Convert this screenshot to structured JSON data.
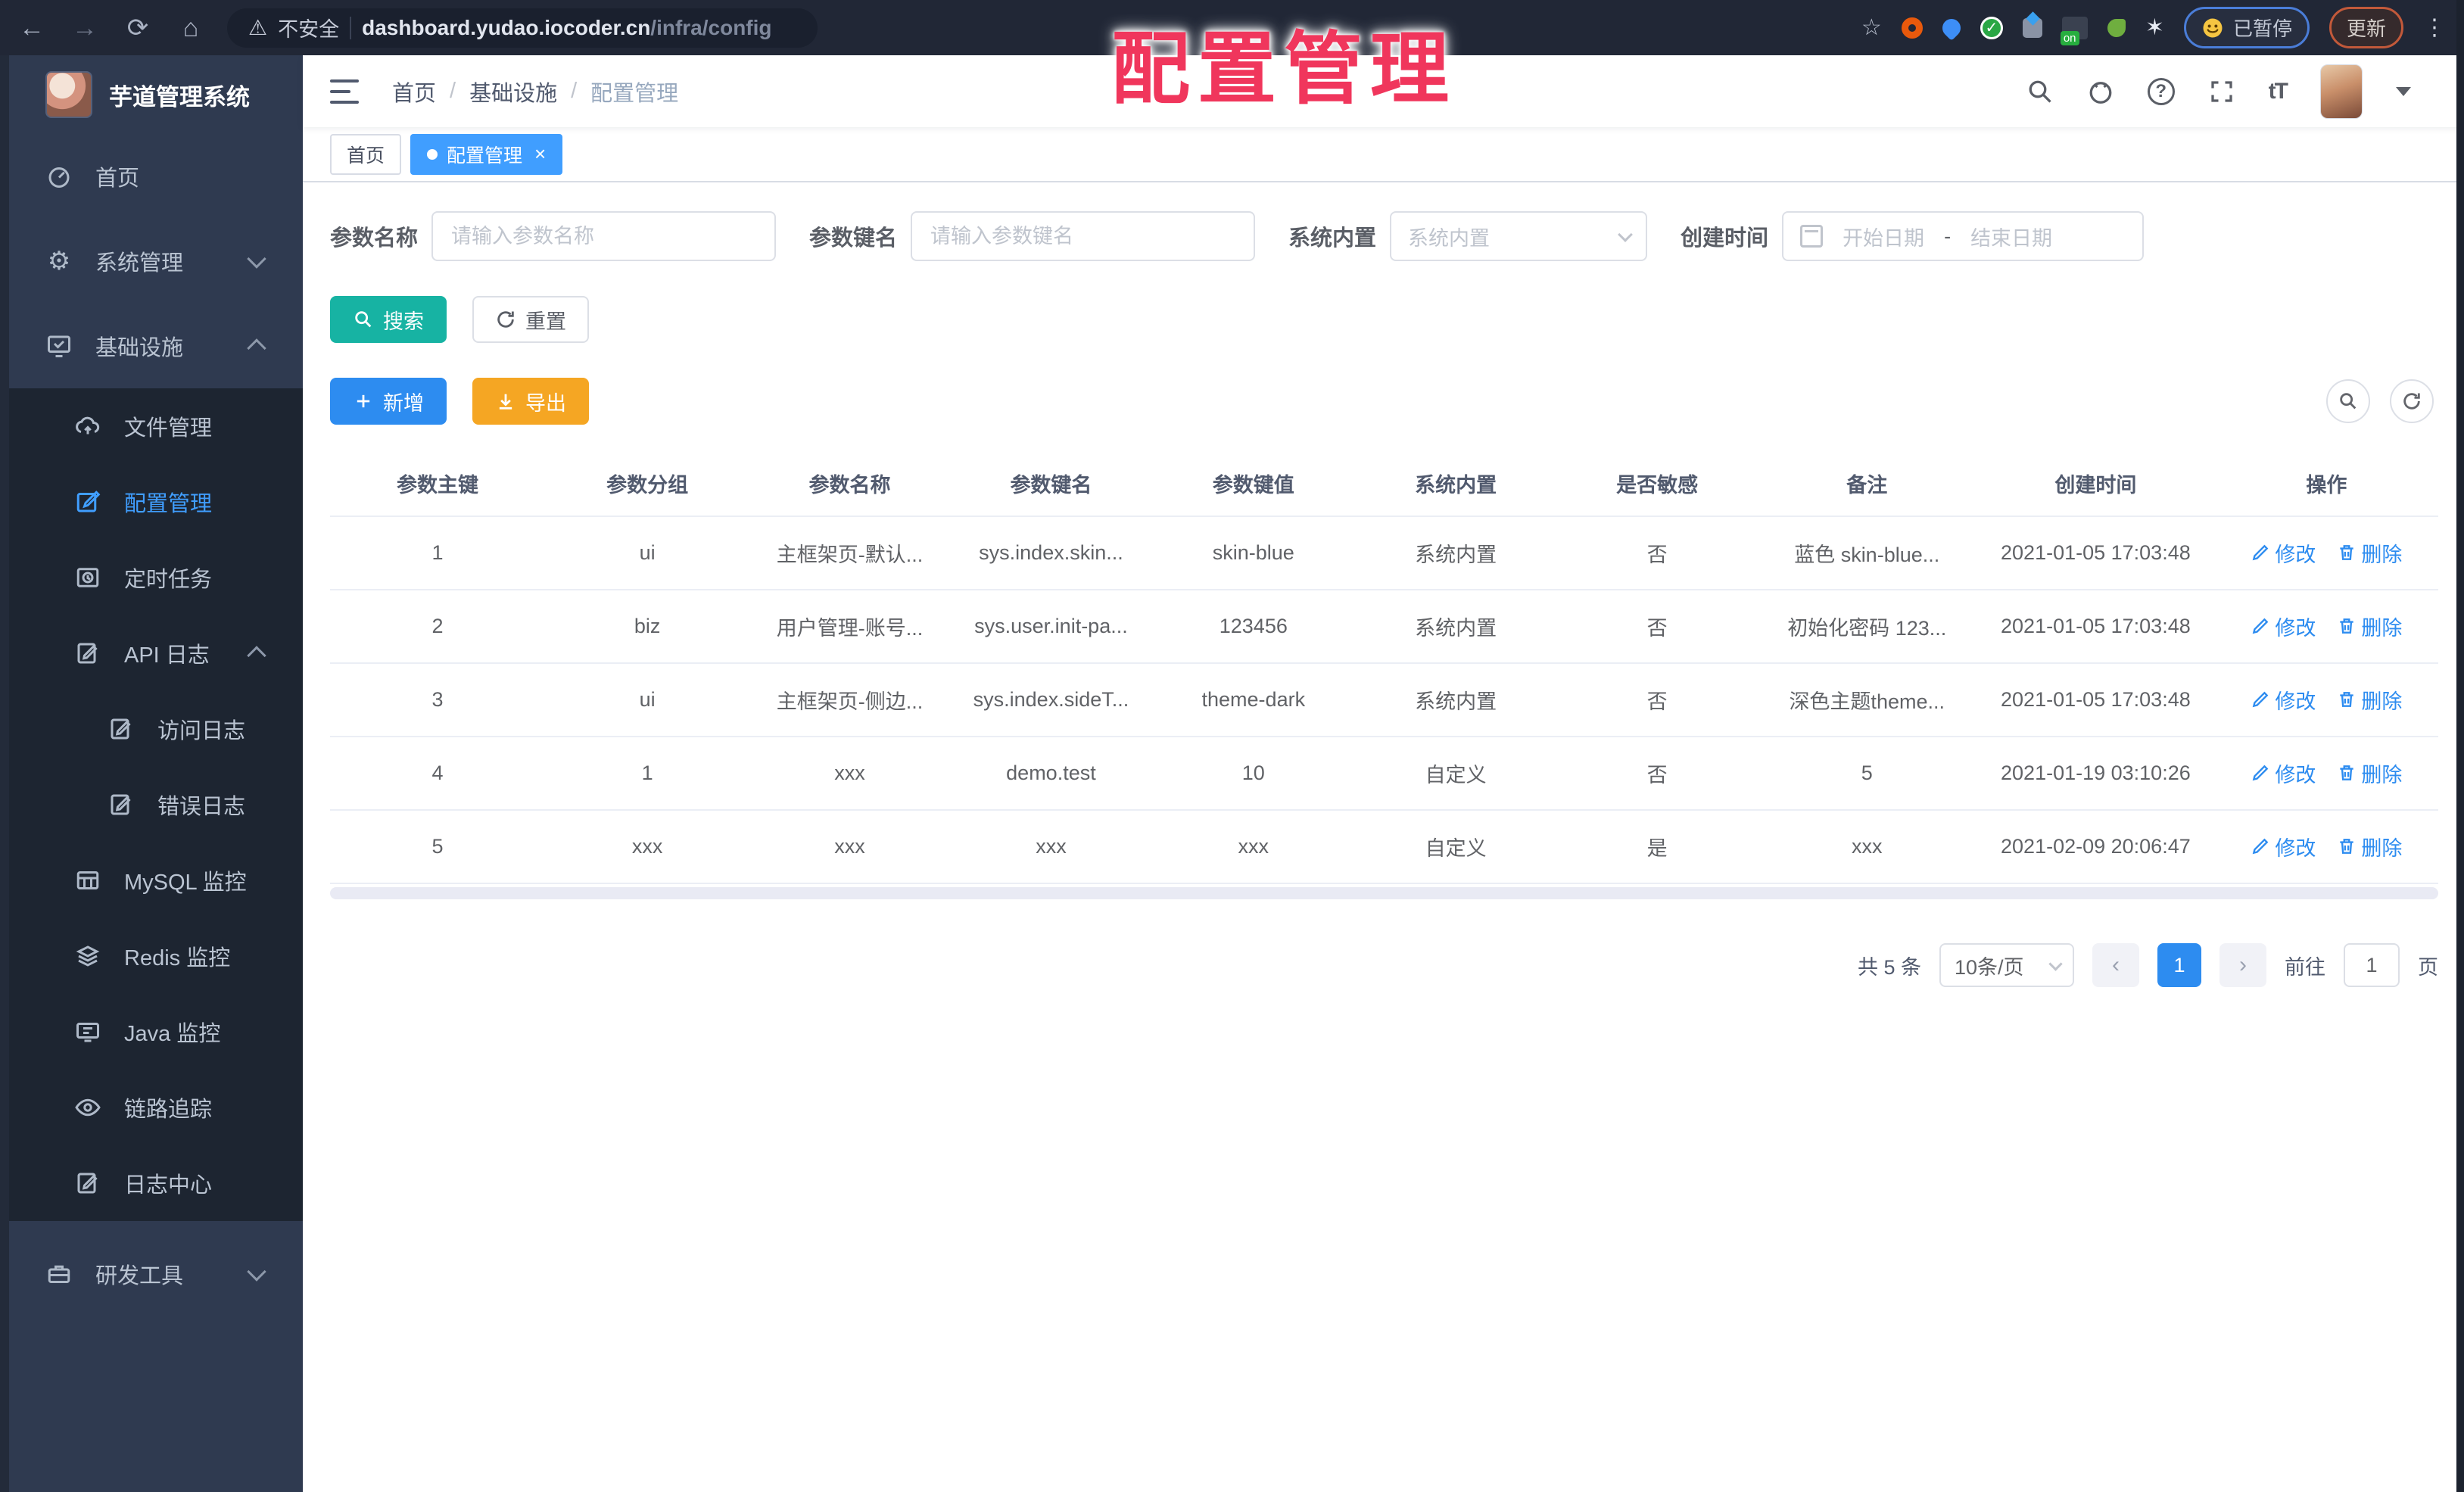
{
  "browser": {
    "security_label": "不安全",
    "url_host": "dashboard.yudao.iocoder.cn",
    "url_path": "/infra/config",
    "paused_chip": "已暂停",
    "update_chip": "更新"
  },
  "overlay_title": "配置管理",
  "sidebar": {
    "title": "芋道管理系统",
    "top_items": [
      {
        "label": "首页",
        "icon": "dashboard-icon"
      },
      {
        "label": "系统管理",
        "icon": "gear-icon",
        "chevron": "down"
      },
      {
        "label": "基础设施",
        "icon": "infrastructure-icon",
        "chevron": "up"
      }
    ],
    "sub_items": [
      {
        "label": "文件管理",
        "icon": "cloud-icon"
      },
      {
        "label": "配置管理",
        "icon": "edit-square-icon",
        "active": true
      },
      {
        "label": "定时任务",
        "icon": "timer-icon"
      },
      {
        "label": "API 日志",
        "icon": "doc-edit-icon",
        "chevron": "up"
      },
      {
        "label": "访问日志",
        "icon": "doc-edit-icon",
        "deep": true
      },
      {
        "label": "错误日志",
        "icon": "doc-edit-icon",
        "deep": true
      },
      {
        "label": "MySQL 监控",
        "icon": "database-icon"
      },
      {
        "label": "Redis 监控",
        "icon": "layers-icon"
      },
      {
        "label": "Java 监控",
        "icon": "java-monitor-icon"
      },
      {
        "label": "链路追踪",
        "icon": "eye-icon"
      },
      {
        "label": "日志中心",
        "icon": "doc-edit-icon"
      }
    ],
    "bottom_items": [
      {
        "label": "研发工具",
        "icon": "toolbox-icon",
        "chevron": "down"
      }
    ]
  },
  "header": {
    "breadcrumb": [
      "首页",
      "基础设施",
      "配置管理"
    ],
    "breadcrumb_separator": "/"
  },
  "tabs": [
    {
      "label": "首页"
    },
    {
      "label": "配置管理"
    }
  ],
  "filters": {
    "name_label": "参数名称",
    "name_placeholder": "请输入参数名称",
    "key_label": "参数键名",
    "key_placeholder": "请输入参数键名",
    "type_label": "系统内置",
    "type_placeholder": "系统内置",
    "time_label": "创建时间",
    "time_start_placeholder": "开始日期",
    "time_separator": "-",
    "time_end_placeholder": "结束日期"
  },
  "toolbar": {
    "search_label": "搜索",
    "reset_label": "重置",
    "add_label": "新增",
    "export_label": "导出"
  },
  "table": {
    "columns": [
      "参数主键",
      "参数分组",
      "参数名称",
      "参数键名",
      "参数键值",
      "系统内置",
      "是否敏感",
      "备注",
      "创建时间",
      "操作"
    ],
    "rows": [
      {
        "cells": [
          "1",
          "ui",
          "主框架页-默认...",
          "sys.index.skin...",
          "skin-blue",
          "系统内置",
          "否",
          "蓝色 skin-blue...",
          "2021-01-05 17:03:48"
        ]
      },
      {
        "cells": [
          "2",
          "biz",
          "用户管理-账号...",
          "sys.user.init-pa...",
          "123456",
          "系统内置",
          "否",
          "初始化密码 123...",
          "2021-01-05 17:03:48"
        ]
      },
      {
        "cells": [
          "3",
          "ui",
          "主框架页-侧边...",
          "sys.index.sideT...",
          "theme-dark",
          "系统内置",
          "否",
          "深色主题theme...",
          "2021-01-05 17:03:48"
        ]
      },
      {
        "cells": [
          "4",
          "1",
          "xxx",
          "demo.test",
          "10",
          "自定义",
          "否",
          "5",
          "2021-01-19 03:10:26"
        ]
      },
      {
        "cells": [
          "5",
          "xxx",
          "xxx",
          "xxx",
          "xxx",
          "自定义",
          "是",
          "xxx",
          "2021-02-09 20:06:47"
        ]
      }
    ],
    "edit_label": "修改",
    "delete_label": "删除"
  },
  "pagination": {
    "total": "共 5 条",
    "page_size": "10条/页",
    "current_page": "1",
    "goto_label": "前往",
    "goto_value": "1",
    "page_unit": "页"
  },
  "colors": {
    "primary": "#2d8cf0",
    "sidebar_active": "#409eff",
    "search_teal": "#17b3a3",
    "export_amber": "#f5a623",
    "overlay_pink": "#f0365c"
  }
}
